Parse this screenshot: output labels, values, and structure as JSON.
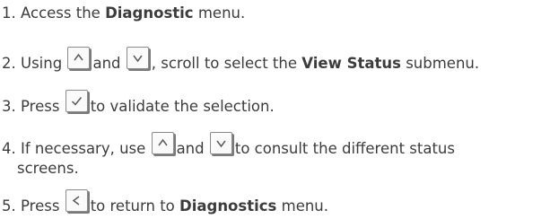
{
  "steps": [
    {
      "num": "1.",
      "pre": "Access the",
      "bold": "Diagnostic",
      "post": "menu."
    },
    {
      "num": "2.",
      "pre": "Using",
      "mid": "and",
      "post1": ", scroll to select the",
      "bold": "View Status",
      "post2": "submenu.",
      "keys": [
        "up-arrow-icon",
        "down-arrow-icon"
      ]
    },
    {
      "num": "3.",
      "pre": "Press",
      "post": "to validate the selection.",
      "keys": [
        "check-icon"
      ]
    },
    {
      "num": "4.",
      "pre": "If necessary, use",
      "mid": "and",
      "post": "to consult the different status",
      "cont": "screens.",
      "keys": [
        "up-arrow-icon",
        "down-arrow-icon"
      ]
    },
    {
      "num": "5.",
      "pre": "Press",
      "post1": "to return to",
      "bold": "Diagnostics",
      "post2": "menu.",
      "keys": [
        "back-arrow-icon"
      ]
    }
  ],
  "colors": {
    "text": "#3c3c3c",
    "key_border": "#8a8a8a",
    "key_shadow": "#7a7a7a"
  }
}
